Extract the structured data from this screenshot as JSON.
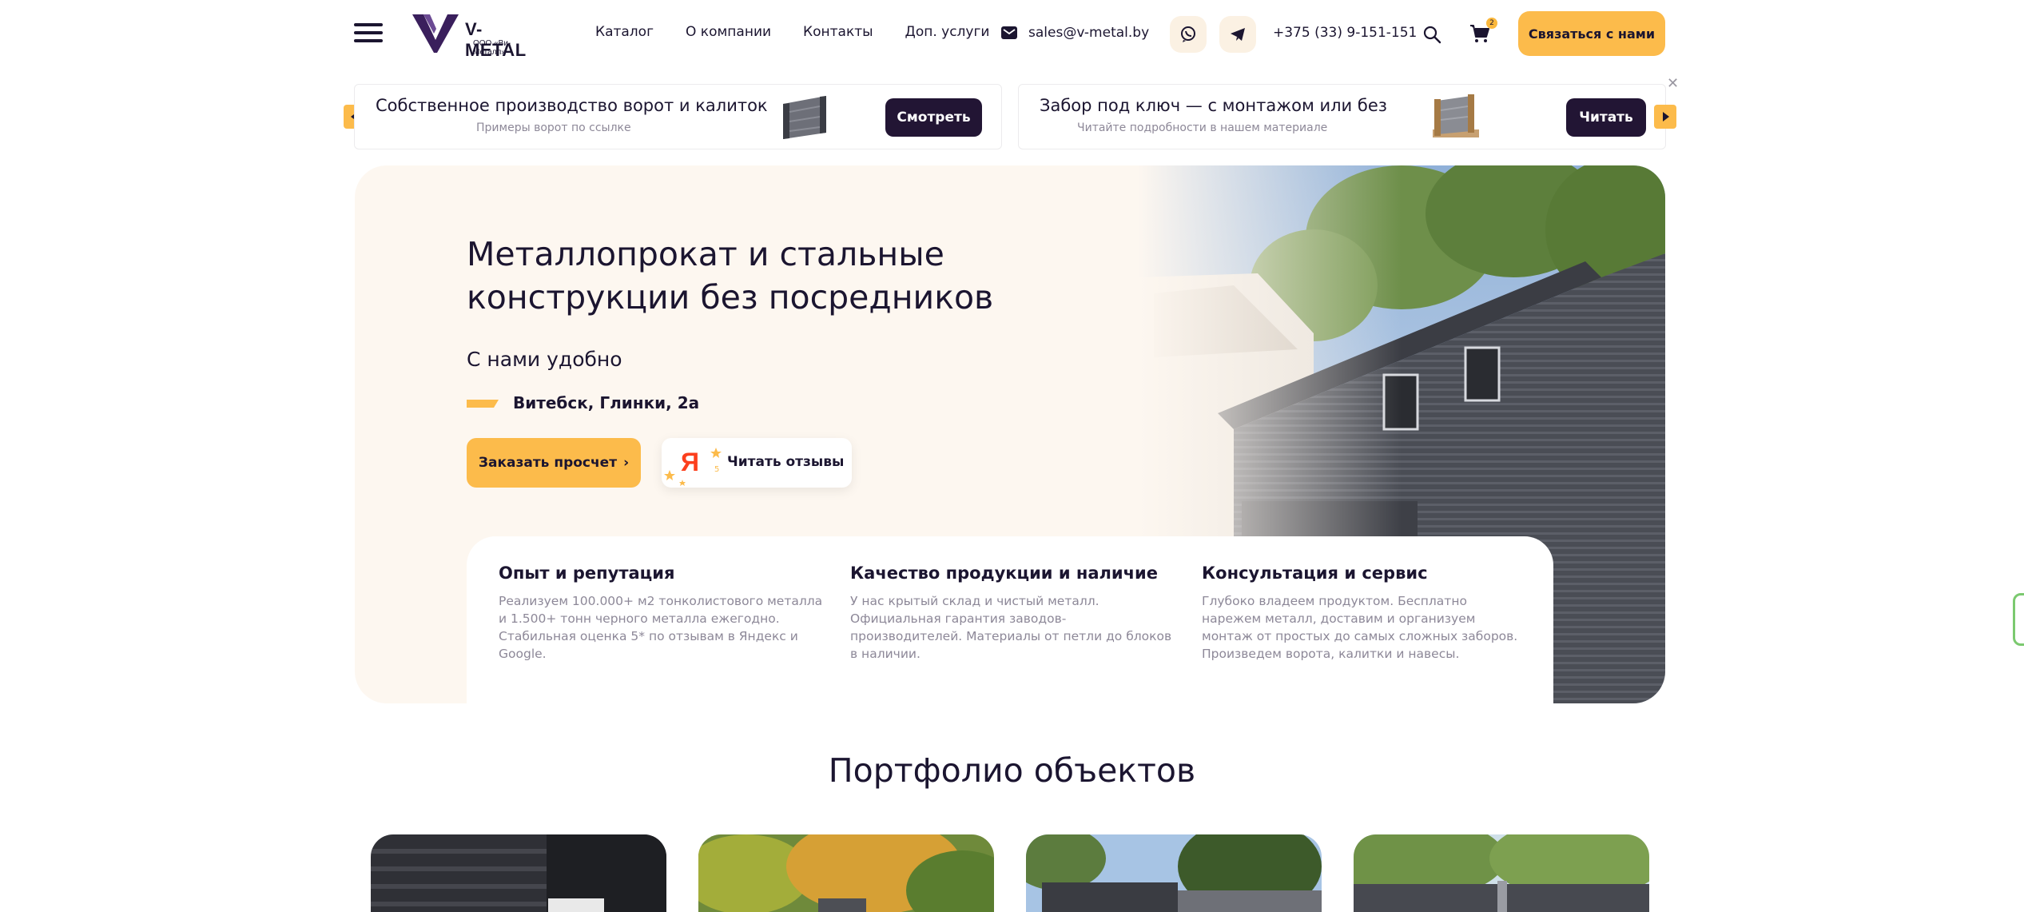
{
  "header": {
    "logo_name": "V-METAL",
    "logo_sub": "ООО «Ви-Металл»",
    "nav": [
      "Каталог",
      "О компании",
      "Контакты",
      "Доп. услуги"
    ],
    "email": "sales@v-metal.by",
    "phone": "+375 (33) 9-151-151",
    "cart_count": "2",
    "contact_button": "Связаться с нами",
    "icons": [
      "menu-icon",
      "mail-icon",
      "viber-icon",
      "telegram-icon",
      "search-icon",
      "cart-icon"
    ]
  },
  "promos": [
    {
      "title": "Собственное производство ворот и калиток",
      "subtitle": "Примеры ворот по ссылке",
      "button": "Смотреть"
    },
    {
      "title": "Забор под ключ — с монтажом или без",
      "subtitle": "Читайте подробности в нашем материале",
      "button": "Читать"
    }
  ],
  "hero": {
    "title": "Металлопрокат и стальные конструкции без посредников",
    "subtitle": "С нами удобно",
    "address": "Витебск, Глинки, 2а",
    "order_button": "Заказать просчет",
    "reviews_button": "Читать отзывы",
    "reviews_logo": "Я",
    "rating_label": "5"
  },
  "features": [
    {
      "title": "Опыт и репутация",
      "text": "Реализуем 100.000+ м2 тонколистового металла и 1.500+ тонн черного металла ежегодно. Стабильная оценка 5* по отзывам в Яндекс и Google."
    },
    {
      "title": "Качество продукции и наличие",
      "text": "У нас крытый склад и чистый металл. Официальная гарантия заводов-производителей. Материалы от петли до блоков в наличии."
    },
    {
      "title": "Консультация и сервис",
      "text": "Глубоко владеем продуктом. Бесплатно нарежем металл, доставим и организуем монтаж от простых до самых сложных заборов. Произведем ворота, калитки и навесы."
    }
  ],
  "portfolio": {
    "title": "Портфолио объектов"
  },
  "colors": {
    "accent": "#fcbb4b",
    "dark": "#221534",
    "text": "#1b1530",
    "muted": "#8d8898",
    "hero_bg": "#fdf7f0"
  }
}
